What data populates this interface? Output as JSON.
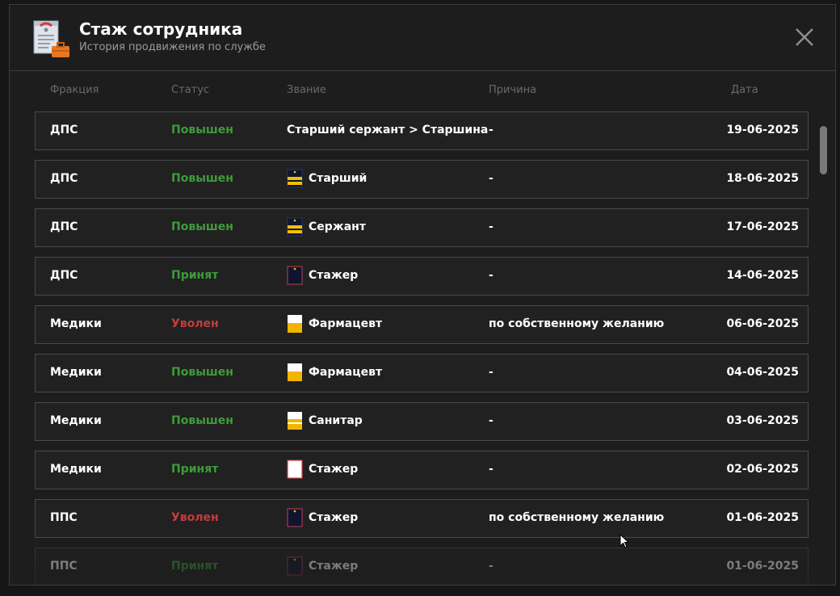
{
  "header": {
    "title": "Стаж сотрудника",
    "subtitle": "История продвижения по службе"
  },
  "columns": {
    "faction": "Фракция",
    "status": "Статус",
    "rank": "Звание",
    "reason": "Причина",
    "date": "Дата"
  },
  "colors": {
    "promoted": "#3f9b3c",
    "hired": "#3f9b3c",
    "fired": "#c83a3a"
  },
  "rows": [
    {
      "faction": "ДПС",
      "status": "Повышен",
      "status_type": "green",
      "badge": "none",
      "rank": "Старший сержант > Старшина",
      "reason": "-",
      "date": "19-06-2025"
    },
    {
      "faction": "ДПС",
      "status": "Повышен",
      "status_type": "green",
      "badge": "dps-stripes",
      "rank": "Старший",
      "reason": "-",
      "date": "18-06-2025"
    },
    {
      "faction": "ДПС",
      "status": "Повышен",
      "status_type": "green",
      "badge": "dps-stripes",
      "rank": "Сержант",
      "reason": "-",
      "date": "17-06-2025"
    },
    {
      "faction": "ДПС",
      "status": "Принят",
      "status_type": "green",
      "badge": "dark-plain",
      "rank": "Стажер",
      "reason": "-",
      "date": "14-06-2025"
    },
    {
      "faction": "Медики",
      "status": "Уволен",
      "status_type": "red",
      "badge": "med-stripe",
      "rank": "Фармацевт",
      "reason": "по собственному желанию",
      "date": "06-06-2025"
    },
    {
      "faction": "Медики",
      "status": "Повышен",
      "status_type": "green",
      "badge": "med-stripe",
      "rank": "Фармацевт",
      "reason": "-",
      "date": "04-06-2025"
    },
    {
      "faction": "Медики",
      "status": "Повышен",
      "status_type": "green",
      "badge": "med-stripes",
      "rank": "Санитар",
      "reason": "-",
      "date": "03-06-2025"
    },
    {
      "faction": "Медики",
      "status": "Принят",
      "status_type": "green",
      "badge": "med-plain",
      "rank": "Стажер",
      "reason": "-",
      "date": "02-06-2025"
    },
    {
      "faction": "ППС",
      "status": "Уволен",
      "status_type": "red",
      "badge": "dark-plain",
      "rank": "Стажер",
      "reason": "по собственному желанию",
      "date": "01-06-2025"
    },
    {
      "faction": "ППС",
      "status": "Принят",
      "status_type": "green",
      "badge": "dark-plain",
      "rank": "Стажер",
      "reason": "-",
      "date": "01-06-2025"
    }
  ]
}
